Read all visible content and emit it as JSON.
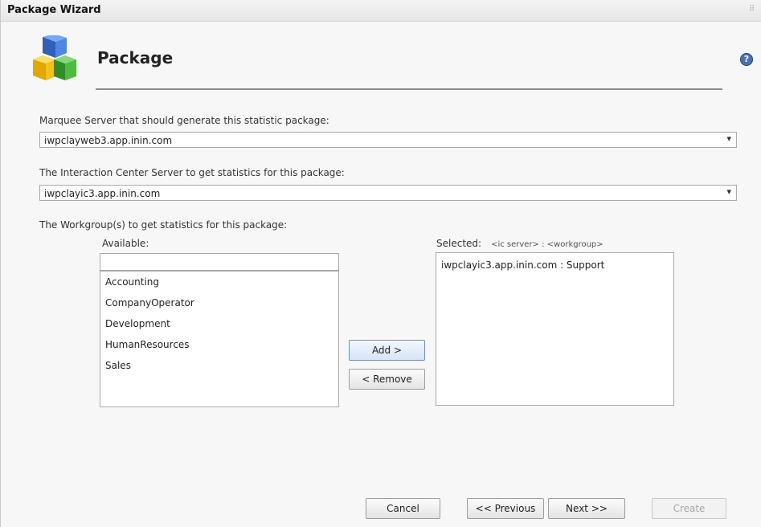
{
  "window": {
    "title": "Package Wizard"
  },
  "header": {
    "heading": "Package",
    "help_icon_glyph": "?"
  },
  "marquee_server": {
    "label": "Marquee Server that should generate this statistic package:",
    "value": "iwpclayweb3.app.inin.com"
  },
  "ic_server": {
    "label": "The Interaction Center Server to get statistics for this package:",
    "value": "iwpclayic3.app.inin.com"
  },
  "workgroups": {
    "label": "The Workgroup(s) to get statistics for this package:",
    "available_label": "Available:",
    "filter_value": "",
    "available_items": [
      "Accounting",
      "CompanyOperator",
      "Development",
      "HumanResources",
      "Sales"
    ],
    "selected_label": "Selected:",
    "selected_format": "<ic server> : <workgroup>",
    "selected_items": [
      "iwpclayic3.app.inin.com : Support"
    ],
    "add_label": "Add >",
    "remove_label": "< Remove"
  },
  "footer": {
    "cancel_label": "Cancel",
    "previous_label": "<< Previous",
    "next_label": "Next >>",
    "create_label": "Create"
  },
  "icons": {
    "package": "package-cubes-icon",
    "help": "help-icon",
    "dropdown": "chevron-down-icon"
  },
  "colors": {
    "cube_blue": "#3b6fd1",
    "cube_yellow": "#f2c21b",
    "cube_green": "#3fa535",
    "primary_button": "#d7e4f6"
  }
}
